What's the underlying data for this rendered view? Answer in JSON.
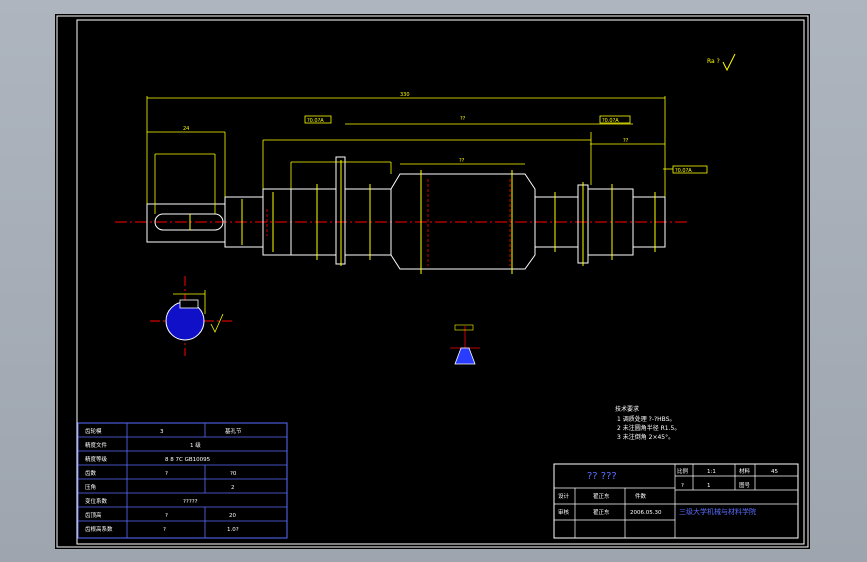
{
  "colors": {
    "background": "#000000",
    "frame": "#ffffff",
    "centerline": "#ff0000",
    "dimension": "#ffff00",
    "outline": "#ffffff",
    "section_fill": "#0000ff",
    "weld_fill": "#2a3cff",
    "table_line": "#5a6cff"
  },
  "drawing": {
    "roughness_symbol": "Ra ?",
    "dims": {
      "overall": "330",
      "key_len": "24",
      "mid_len": "??",
      "right_len": "??",
      "gear_len": "??"
    },
    "tolerance_frames": {
      "left": "?0.0?A",
      "mid": "?0.0?A",
      "right": "?0.0?A"
    },
    "tech_req": {
      "title": "技术要求",
      "items": [
        "1 调质处理 ?-?HBS。",
        "2 未注圆角半径 R1.5。",
        "3 未注倒角 2×45°。"
      ]
    }
  },
  "params_table": {
    "rows": [
      {
        "label": "齿轮模",
        "v1": "3",
        "v2": "基孔节"
      },
      {
        "label": "精度文件",
        "v1": "",
        "v2": "1 级"
      },
      {
        "label": "精度等级",
        "v1": "8 8 7C  GB10095",
        "v2": ""
      },
      {
        "label": "齿数",
        "v1": "?",
        "v2": "?0"
      },
      {
        "label": "压角",
        "v1": "",
        "v2": "2"
      },
      {
        "label": "变位系数",
        "v1": "?????",
        "v2": ""
      },
      {
        "label": "齿顶高",
        "v1": "?",
        "v2": "20"
      },
      {
        "label": "齿根高系数",
        "v1": "?",
        "v2": "1.0?"
      }
    ]
  },
  "title_block": {
    "logo": "?? ???",
    "designer_label": "设计",
    "designer_name": "翟正东",
    "checker_label": "审核",
    "checker_name": "翟正东",
    "date": "2006.05.30",
    "qty_label": "件数",
    "qty": "?",
    "scale_label": "比例",
    "scale": "1:1",
    "material_label": "材料",
    "material": "45",
    "sheet_label": "图号",
    "sheet": "1",
    "title": "三级大学机械与材料学院"
  }
}
